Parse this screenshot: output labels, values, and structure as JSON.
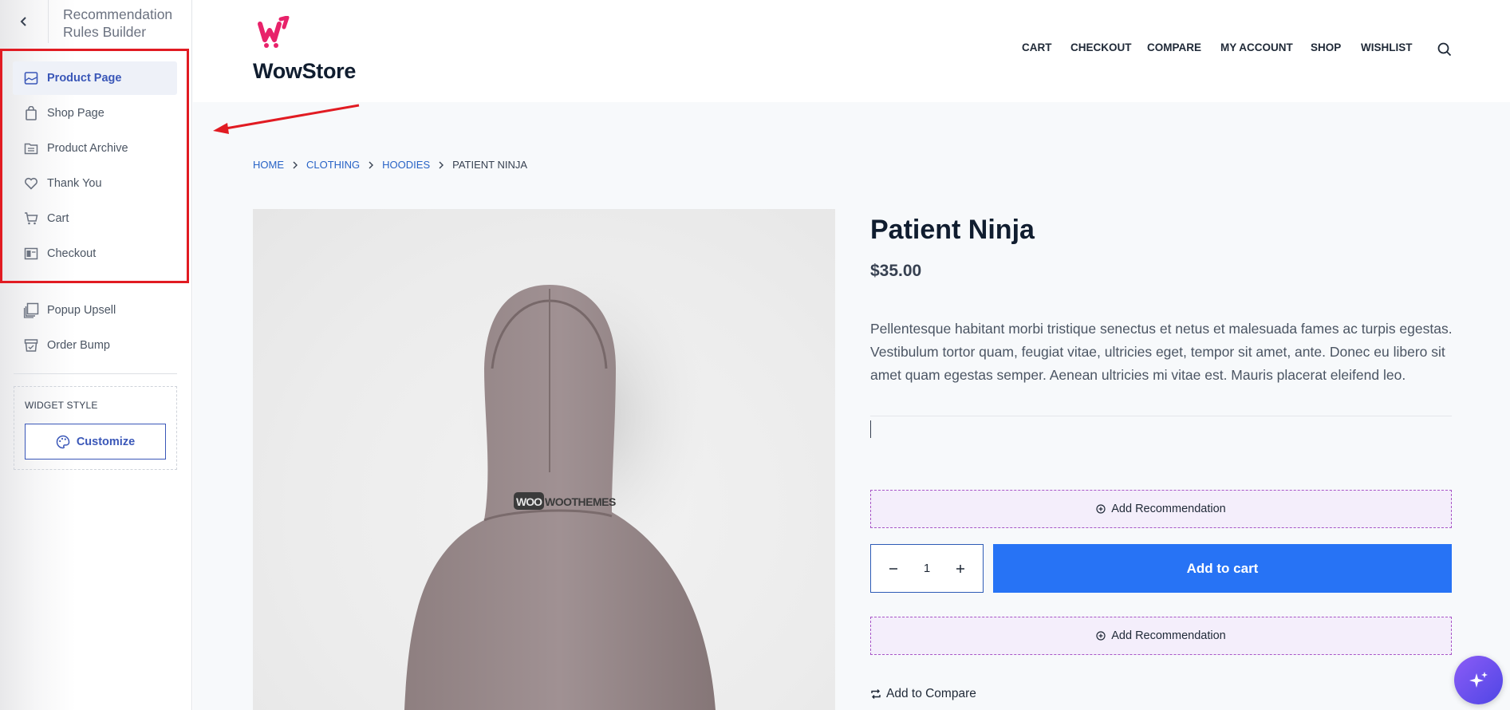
{
  "sidebar": {
    "title": "Recommendation Rules Builder",
    "items": [
      {
        "label": "Product Page",
        "icon": "image-icon",
        "active": true
      },
      {
        "label": "Shop Page",
        "icon": "shopping-bag-icon"
      },
      {
        "label": "Product Archive",
        "icon": "folder-icon"
      },
      {
        "label": "Thank You",
        "icon": "heart-icon"
      },
      {
        "label": "Cart",
        "icon": "cart-icon"
      },
      {
        "label": "Checkout",
        "icon": "checkout-icon"
      },
      {
        "label": "Popup Upsell",
        "icon": "popup-icon"
      },
      {
        "label": "Order Bump",
        "icon": "order-bump-icon"
      }
    ],
    "widget_style": {
      "title": "WIDGET STYLE",
      "customize_label": "Customize"
    }
  },
  "store": {
    "logo_text": "WowStore",
    "nav": [
      "CART",
      "CHECKOUT",
      "COMPARE",
      "MY ACCOUNT",
      "SHOP",
      "WISHLIST"
    ]
  },
  "breadcrumb": [
    "HOME",
    "CLOTHING",
    "HOODIES",
    "PATIENT NINJA"
  ],
  "product": {
    "title": "Patient Ninja",
    "price": "$35.00",
    "description": "Pellentesque habitant morbi tristique senectus et netus et malesuada fames ac turpis egestas. Vestibulum tortor quam, feugiat vitae, ultricies eget, tempor sit amet, ante. Donec eu libero sit amet quam egestas semper. Aenean ultricies mi vitae est. Mauris placerat eleifend leo.",
    "image_label": "WOOTHEMES",
    "quantity": "1",
    "add_to_cart": "Add to cart",
    "add_recommendation": "Add Recommendation",
    "add_to_compare": "Add to Compare"
  },
  "colors": {
    "accent": "#3a57b8",
    "cart_button": "#2773f5",
    "highlight": "#e11b22",
    "brand": "#e8226a"
  }
}
